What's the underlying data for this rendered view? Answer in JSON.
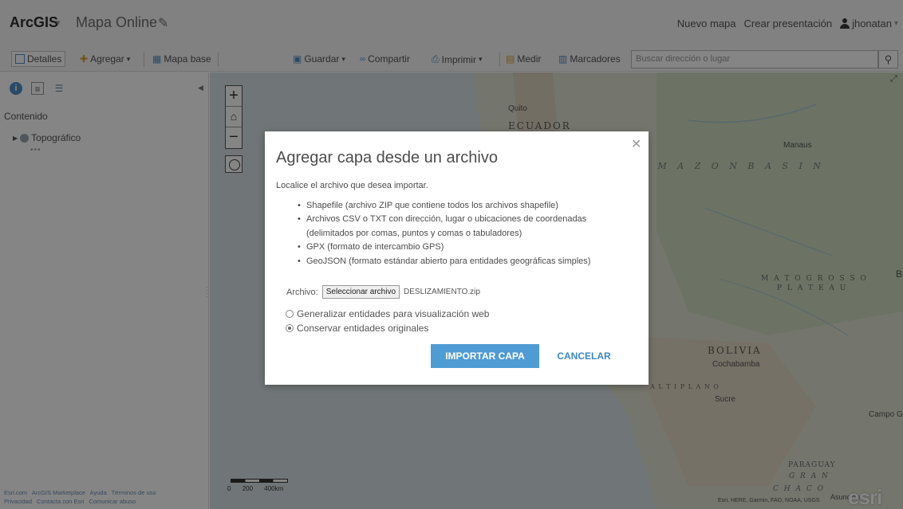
{
  "header": {
    "brand": "ArcGIS",
    "map_title": "Mapa Online",
    "new_map": "Nuevo mapa",
    "create_presentation": "Crear presentación",
    "user": "jhonatan"
  },
  "toolbar": {
    "details": "Detalles",
    "add": "Agregar",
    "basemap": "Mapa base",
    "save": "Guardar",
    "share": "Compartir",
    "print": "Imprimir",
    "measure": "Medir",
    "bookmarks": "Marcadores",
    "search_placeholder": "Buscar dirección o lugar"
  },
  "panel": {
    "heading": "Contenido",
    "layer": "Topográfico",
    "dots": "•••",
    "footer_line1": [
      "Esri.com",
      "ArcGIS Marketplace",
      "Ayuda",
      "Términos de uso"
    ],
    "footer_line2": [
      "Privacidad",
      "Contacta con Esri",
      "Comunicar abuso"
    ]
  },
  "map": {
    "labels": {
      "quito": "Quito",
      "ecuador": "ECUADOR",
      "manaus": "Manaus",
      "amazon_basin": "A M A Z O N     B A S I N",
      "mato_grosso": "M A T O   G R O S S O",
      "plateau": "P L A T E A U",
      "bolivia": "BOLIVIA",
      "cochabamba": "Cochabamba",
      "altiplano": "A L T I P L A N O",
      "sucre": "Sucre",
      "campo_grande": "Campo Gr",
      "paraguay": "PARAGUAY",
      "gran": "G R A N",
      "chaco": "C H A C O",
      "asuncion": "Asunción",
      "b_edge": "B"
    },
    "scale": [
      "0",
      "200",
      "400km"
    ],
    "attribution": "Esri, HERE, Garmin, FAO, NOAA, USGS",
    "logo": "esri"
  },
  "dialog": {
    "title": "Agregar capa desde un archivo",
    "intro": "Localice el archivo que desea importar.",
    "items": [
      "Shapefile (archivo ZIP que contiene todos los archivos shapefile)",
      "Archivos CSV o TXT con dirección, lugar o ubicaciones de coordenadas",
      "(delimitados por comas, puntos y comas o tabuladores)",
      "GPX (formato de intercambio GPS)",
      "GeoJSON (formato estándar abierto para entidades geográficas simples)"
    ],
    "file_label": "Archivo:",
    "file_button": "Seleccionar archivo",
    "file_name": "DESLIZAMIENTO.zip",
    "option_generalize": "Generalizar entidades para visualización web",
    "option_keep": "Conservar entidades originales",
    "import_button": "IMPORTAR CAPA",
    "cancel_button": "CANCELAR"
  }
}
